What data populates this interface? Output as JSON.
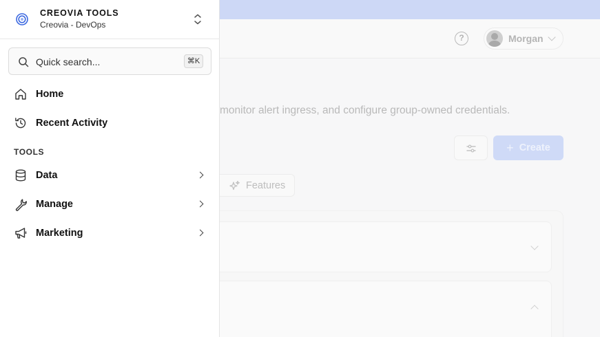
{
  "background": {
    "user": {
      "name": "Morgan"
    },
    "help_glyph": "?",
    "description": "monitor alert ingress, and configure group-owned credentials.",
    "create_button": {
      "label": "Create",
      "plus": "+"
    },
    "features_tab": {
      "label": "Features"
    },
    "colors": {
      "banner": "#cdd8f6",
      "primary_dimmed": "#cfdaf7"
    }
  },
  "sidebar": {
    "org": {
      "name": "CREOVIA TOOLS",
      "subtitle": "Creovia - DevOps"
    },
    "search": {
      "placeholder": "Quick search...",
      "shortcut": "⌘K"
    },
    "nav": [
      {
        "label": "Home",
        "icon": "home-icon"
      },
      {
        "label": "Recent Activity",
        "icon": "history-icon"
      }
    ],
    "section_label": "TOOLS",
    "tools": [
      {
        "label": "Data",
        "icon": "database-icon"
      },
      {
        "label": "Manage",
        "icon": "wrench-icon"
      },
      {
        "label": "Marketing",
        "icon": "megaphone-icon"
      }
    ]
  }
}
